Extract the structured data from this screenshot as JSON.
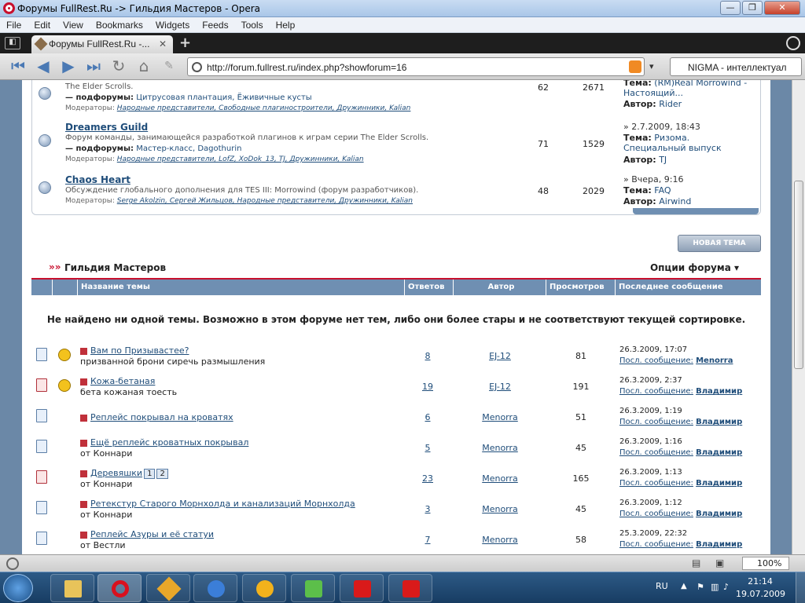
{
  "window": {
    "title": "Форумы FullRest.Ru -> Гильдия Мастеров - Opera"
  },
  "menu": [
    "File",
    "Edit",
    "View",
    "Bookmarks",
    "Widgets",
    "Feeds",
    "Tools",
    "Help"
  ],
  "tab": {
    "label": "Форумы FullRest.Ru -...",
    "close": "✕",
    "new": "+"
  },
  "nav": {
    "url": "http://forum.fullrest.ru/index.php?showforum=16",
    "search": "NIGMA - интеллектуал"
  },
  "subforums": [
    {
      "name": "",
      "line1": "The Elder Scrolls.",
      "sub_label": "— подфорумы:",
      "subs": "Цитрусовая плантация, Ёживичные кусты",
      "mods_label": "Модераторы:",
      "mods": "Народные представители, Свободные плагиностроители, Дружинники, Kalian",
      "topics": "62",
      "posts": "2671",
      "last_date": "",
      "last_topic_label": "Тема:",
      "last_topic": "(RM)Real Morrowind - Настоящий...",
      "last_author_label": "Автор:",
      "last_author": "Rider"
    },
    {
      "name": "Dreamers Guild",
      "line1": "Форум команды, занимающейся разработкой плагинов к играм серии The Elder Scrolls.",
      "sub_label": "— подфорумы:",
      "subs": "Мастер-класс, Dagothurin",
      "mods_label": "Модераторы:",
      "mods": "Народные представители, LofZ, XoDok_13, TJ, Дружинники, Kalian",
      "topics": "71",
      "posts": "1529",
      "last_date": "» 2.7.2009, 18:43",
      "last_topic_label": "Тема:",
      "last_topic": "Ризома. Специальный выпуск",
      "last_author_label": "Автор:",
      "last_author": "TJ"
    },
    {
      "name": "Chaos Heart",
      "line1": "Обсуждение глобального дополнения для TES III: Morrowind (форум разработчиков).",
      "sub_label": "",
      "subs": "",
      "mods_label": "Модераторы:",
      "mods": "Serge Akolzin, Сергей Жильцов, Народные представители, Дружинники, Kalian",
      "topics": "48",
      "posts": "2029",
      "last_date": "» Вчера, 9:16",
      "last_topic_label": "Тема:",
      "last_topic": "FAQ",
      "last_author_label": "Автор:",
      "last_author": "Airwind"
    }
  ],
  "new_topic_button": "НОВАЯ ТЕМА",
  "forum": {
    "title": "Гильдия Мастеров",
    "options": "Опции форума ▾",
    "columns": [
      "Название темы",
      "Ответов",
      "Автор",
      "Просмотров",
      "Последнее сообщение"
    ],
    "notice": "Не найдено ни одной темы. Возможно в этом форуме нет тем, либо они более стары и не соответствуют текущей сортировке."
  },
  "topics": [
    {
      "title": "Вам по Призывастее?",
      "sub": "призванной брони сиречь размышления",
      "replies": "8",
      "author": "EJ-12",
      "views": "81",
      "date": "26.3.2009, 17:07",
      "last_label": "Посл. сообщение:",
      "last_by": "Menorra",
      "hot": false,
      "smile": true,
      "pages": []
    },
    {
      "title": "Кожа-бетаная",
      "sub": "бета кожаная тоесть",
      "replies": "19",
      "author": "EJ-12",
      "views": "191",
      "date": "26.3.2009, 2:37",
      "last_label": "Посл. сообщение:",
      "last_by": "Владимир",
      "hot": true,
      "smile": true,
      "pages": []
    },
    {
      "title": "Реплейс покрывал на кроватях",
      "sub": "",
      "replies": "6",
      "author": "Menorra",
      "views": "51",
      "date": "26.3.2009, 1:19",
      "last_label": "Посл. сообщение:",
      "last_by": "Владимир",
      "hot": false,
      "smile": false,
      "pages": []
    },
    {
      "title": "Ещё реплейс кроватных покрывал",
      "sub": "от Коннари",
      "replies": "5",
      "author": "Menorra",
      "views": "45",
      "date": "26.3.2009, 1:16",
      "last_label": "Посл. сообщение:",
      "last_by": "Владимир",
      "hot": false,
      "smile": false,
      "pages": []
    },
    {
      "title": "Деревяшки",
      "sub": "от Коннари",
      "replies": "23",
      "author": "Menorra",
      "views": "165",
      "date": "26.3.2009, 1:13",
      "last_label": "Посл. сообщение:",
      "last_by": "Владимир",
      "hot": true,
      "smile": false,
      "pages": [
        "1",
        "2"
      ]
    },
    {
      "title": "Ретекстур Старого Морнхолда и канализаций Морнхолда",
      "sub": "от Коннари",
      "replies": "3",
      "author": "Menorra",
      "views": "45",
      "date": "26.3.2009, 1:12",
      "last_label": "Посл. сообщение:",
      "last_by": "Владимир",
      "hot": false,
      "smile": false,
      "pages": []
    },
    {
      "title": "Реплейс Азуры и её статуи",
      "sub": "от Вестли",
      "replies": "7",
      "author": "Menorra",
      "views": "58",
      "date": "25.3.2009, 22:32",
      "last_label": "Посл. сообщение:",
      "last_by": "Владимир",
      "hot": false,
      "smile": false,
      "pages": []
    }
  ],
  "status": {
    "zoom": "100%"
  },
  "taskbar": {
    "lang": "RU",
    "time": "21:14",
    "date": "19.07.2009"
  }
}
